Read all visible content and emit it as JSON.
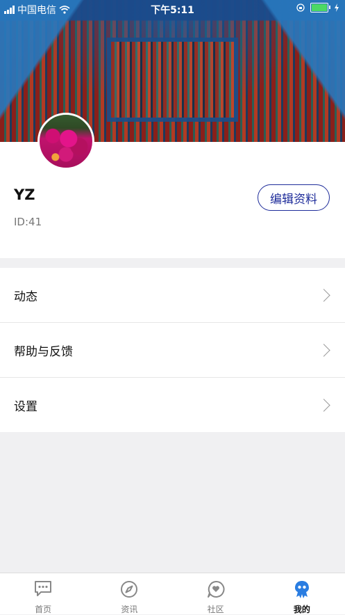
{
  "status_bar": {
    "carrier": "中国电信",
    "time": "下午5:11"
  },
  "profile": {
    "username": "YZ",
    "user_id": "ID:41",
    "edit_button": "编辑资料"
  },
  "menu": {
    "items": [
      {
        "label": "动态"
      },
      {
        "label": "帮助与反馈"
      },
      {
        "label": "设置"
      }
    ]
  },
  "tabbar": {
    "tabs": [
      {
        "label": "首页",
        "icon": "message-icon"
      },
      {
        "label": "资讯",
        "icon": "compass-icon"
      },
      {
        "label": "社区",
        "icon": "chat-heart-icon"
      },
      {
        "label": "我的",
        "icon": "profile-icon",
        "active": true
      }
    ],
    "active_color": "#2a7de1",
    "inactive_color": "#888888"
  },
  "colors": {
    "accent": "#1e2c9a",
    "battery": "#4cd964"
  }
}
